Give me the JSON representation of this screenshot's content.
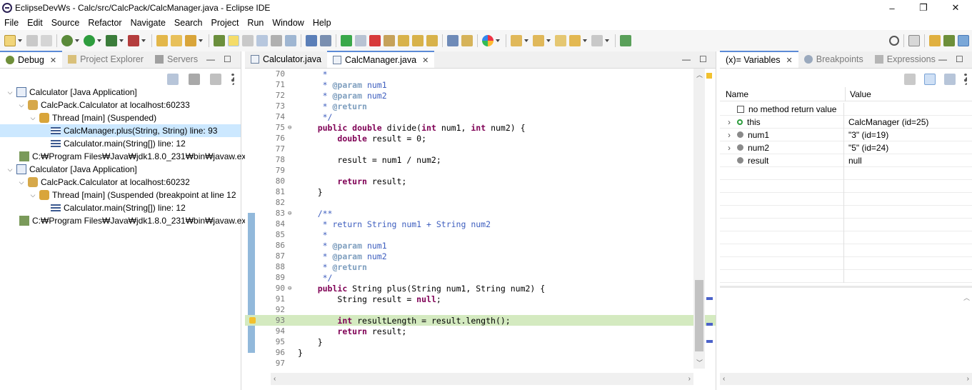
{
  "window": {
    "title": "EclipseDevWs - Calc/src/CalcPack/CalcManager.java - Eclipse IDE",
    "minimize": "–",
    "restore": "❐",
    "close": "✕"
  },
  "menu": [
    "File",
    "Edit",
    "Source",
    "Refactor",
    "Navigate",
    "Search",
    "Project",
    "Run",
    "Window",
    "Help"
  ],
  "debug_pane": {
    "tabs": [
      {
        "label": "Debug",
        "active": true
      },
      {
        "label": "Project Explorer",
        "active": false
      },
      {
        "label": "Servers",
        "active": false
      }
    ],
    "tree": [
      {
        "indent": 0,
        "twisty": "⌵",
        "icon": "java-app-icon",
        "label": "Calculator [Java Application]"
      },
      {
        "indent": 1,
        "twisty": "⌵",
        "icon": "debug-target-icon",
        "label": "CalcPack.Calculator at localhost:60233"
      },
      {
        "indent": 2,
        "twisty": "⌵",
        "icon": "thread-suspended-icon",
        "label": "Thread [main] (Suspended)"
      },
      {
        "indent": 3,
        "twisty": "",
        "icon": "stack-frame-icon",
        "label": "CalcManager.plus(String, String) line: 93",
        "selected": true
      },
      {
        "indent": 3,
        "twisty": "",
        "icon": "stack-frame-icon",
        "label": "Calculator.main(String[]) line: 12"
      },
      {
        "indent": 1,
        "twisty": "",
        "icon": "process-icon",
        "label": "C:₩Program Files₩Java₩jdk1.8.0_231₩bin₩javaw.ex"
      },
      {
        "indent": 0,
        "twisty": "⌵",
        "icon": "java-app-icon",
        "label": "Calculator [Java Application]"
      },
      {
        "indent": 1,
        "twisty": "⌵",
        "icon": "debug-target-icon",
        "label": "CalcPack.Calculator at localhost:60232"
      },
      {
        "indent": 2,
        "twisty": "⌵",
        "icon": "thread-suspended-icon",
        "label": "Thread [main] (Suspended (breakpoint at line 12"
      },
      {
        "indent": 3,
        "twisty": "",
        "icon": "stack-frame-icon",
        "label": "Calculator.main(String[]) line: 12"
      },
      {
        "indent": 1,
        "twisty": "",
        "icon": "process-icon",
        "label": "C:₩Program Files₩Java₩jdk1.8.0_231₩bin₩javaw.ex"
      }
    ]
  },
  "editor": {
    "tabs": [
      {
        "label": "Calculator.java",
        "active": false
      },
      {
        "label": "CalcManager.java",
        "active": true
      }
    ],
    "lines": [
      {
        "n": "70",
        "fold": "",
        "html": "<span class='cm'>     *</span>"
      },
      {
        "n": "71",
        "fold": "",
        "html": "<span class='cm'>     * <span class='tag'>@param</span> num1</span>"
      },
      {
        "n": "72",
        "fold": "",
        "html": "<span class='cm'>     * <span class='tag'>@param</span> num2</span>"
      },
      {
        "n": "73",
        "fold": "",
        "html": "<span class='cm'>     * <span class='tag'>@return</span></span>"
      },
      {
        "n": "74",
        "fold": "",
        "html": "<span class='cm'>     */</span>"
      },
      {
        "n": "75",
        "fold": "⊖",
        "html": "    <span class='kw'>public double</span> divide(<span class='kw'>int</span> num1, <span class='kw'>int</span> num2) {"
      },
      {
        "n": "76",
        "fold": "",
        "html": "        <span class='kw'>double</span> result = 0;"
      },
      {
        "n": "77",
        "fold": "",
        "html": ""
      },
      {
        "n": "78",
        "fold": "",
        "html": "        result = num1 / num2;"
      },
      {
        "n": "79",
        "fold": "",
        "html": ""
      },
      {
        "n": "80",
        "fold": "",
        "html": "        <span class='kw'>return</span> result;"
      },
      {
        "n": "81",
        "fold": "",
        "html": "    }"
      },
      {
        "n": "82",
        "fold": "",
        "html": ""
      },
      {
        "n": "83",
        "fold": "⊖",
        "html": "<span class='cm'>    /**</span>"
      },
      {
        "n": "84",
        "fold": "",
        "html": "<span class='cm'>     * return String num1 + String num2</span>"
      },
      {
        "n": "85",
        "fold": "",
        "html": "<span class='cm'>     *</span>"
      },
      {
        "n": "86",
        "fold": "",
        "html": "<span class='cm'>     * <span class='tag'>@param</span> num1</span>"
      },
      {
        "n": "87",
        "fold": "",
        "html": "<span class='cm'>     * <span class='tag'>@param</span> num2</span>"
      },
      {
        "n": "88",
        "fold": "",
        "html": "<span class='cm'>     * <span class='tag'>@return</span></span>"
      },
      {
        "n": "89",
        "fold": "",
        "html": "<span class='cm'>     */</span>"
      },
      {
        "n": "90",
        "fold": "⊖",
        "html": "    <span class='kw'>public</span> String plus(String num1, String num2) {"
      },
      {
        "n": "91",
        "fold": "",
        "html": "        String result = <span class='kw'>null</span>;"
      },
      {
        "n": "92",
        "fold": "",
        "html": ""
      },
      {
        "n": "93",
        "fold": "",
        "html": "        <span class='kw'>int</span> resultLength = result.length();",
        "current": true
      },
      {
        "n": "94",
        "fold": "",
        "html": "        <span class='kw'>return</span> result;"
      },
      {
        "n": "95",
        "fold": "",
        "html": "    }"
      },
      {
        "n": "96",
        "fold": "",
        "html": "}"
      },
      {
        "n": "97",
        "fold": "",
        "html": ""
      }
    ]
  },
  "variables_pane": {
    "tabs": [
      {
        "label": "(x)= Variables",
        "active": true
      },
      {
        "label": "Breakpoints",
        "active": false
      },
      {
        "label": "Expressions",
        "active": false
      }
    ],
    "columns": [
      "Name",
      "Value"
    ],
    "rows": [
      {
        "expand": "",
        "icon": "return-value-icon",
        "name": "no method return value",
        "value": ""
      },
      {
        "expand": "›",
        "icon": "field-icon",
        "name": "this",
        "value": "CalcManager  (id=25)"
      },
      {
        "expand": "›",
        "icon": "local-var-icon",
        "name": "num1",
        "value": "\"3\" (id=19)"
      },
      {
        "expand": "›",
        "icon": "local-var-icon",
        "name": "num2",
        "value": "\"5\" (id=24)"
      },
      {
        "expand": "",
        "icon": "local-var-icon",
        "name": "result",
        "value": "null"
      }
    ]
  },
  "colors": {
    "current_line": "#d4eac0",
    "selection": "#cce8ff",
    "keyword": "#7f0055",
    "comment": "#3f5fbf"
  }
}
